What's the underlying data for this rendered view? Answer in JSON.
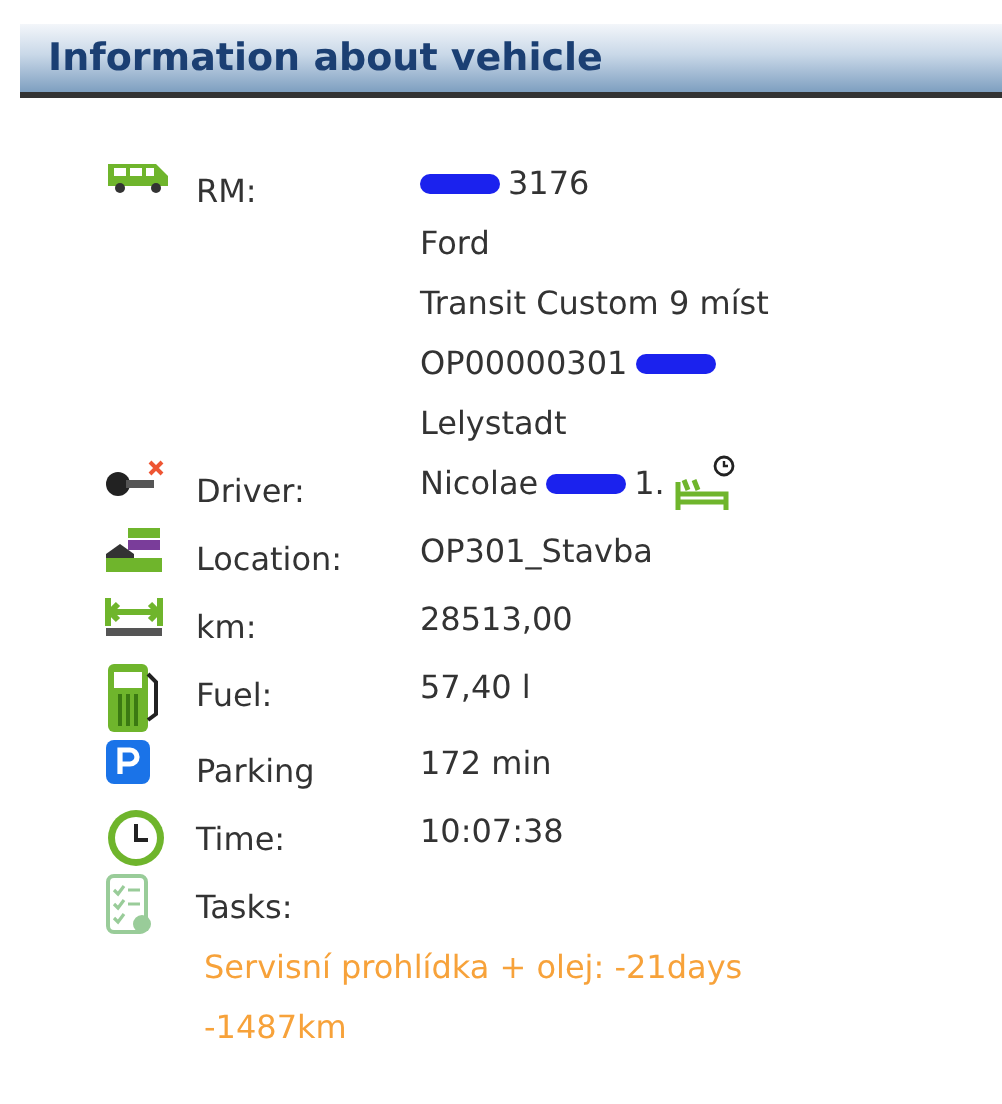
{
  "panel": {
    "title": "Information about vehicle"
  },
  "rows": [
    {
      "kind": "vehicle",
      "label": "RM:",
      "lines": [
        [
          {
            "kind": "redaction"
          },
          {
            "kind": "text",
            "text": "3176"
          }
        ],
        [
          {
            "kind": "text",
            "text": "Ford"
          }
        ],
        [
          {
            "kind": "text",
            "text": "Transit Custom 9 míst"
          }
        ],
        [
          {
            "kind": "text",
            "text": "OP00000301"
          },
          {
            "kind": "redaction"
          }
        ],
        [
          {
            "kind": "text",
            "text": "Lelystadt"
          }
        ]
      ]
    },
    {
      "kind": "driver",
      "label": "Driver:",
      "lines": [
        [
          {
            "kind": "text",
            "text": "Nicolae"
          },
          {
            "kind": "redaction"
          },
          {
            "kind": "text",
            "text": "1."
          }
        ]
      ]
    },
    {
      "kind": "location",
      "label": "Location:",
      "lines": [
        [
          {
            "kind": "text",
            "text": "OP301_Stavba"
          }
        ]
      ]
    },
    {
      "kind": "distance",
      "label": "km:",
      "lines": [
        [
          {
            "kind": "text",
            "text": "28513,00"
          }
        ]
      ]
    },
    {
      "kind": "fuel",
      "label": "Fuel:",
      "lines": [
        [
          {
            "kind": "text",
            "text": "57,40 l"
          }
        ]
      ]
    },
    {
      "kind": "parking",
      "label": "Parking",
      "lines": [
        [
          {
            "kind": "text",
            "text": "172 min"
          }
        ]
      ]
    },
    {
      "kind": "time",
      "label": "Time:",
      "lines": [
        [
          {
            "kind": "text",
            "text": "10:07:38"
          }
        ]
      ]
    },
    {
      "kind": "tasks",
      "label": "Tasks:",
      "lines": []
    }
  ],
  "task_notes": [
    "Servisní prohlídka + olej: -21days",
    "-1487km"
  ]
}
